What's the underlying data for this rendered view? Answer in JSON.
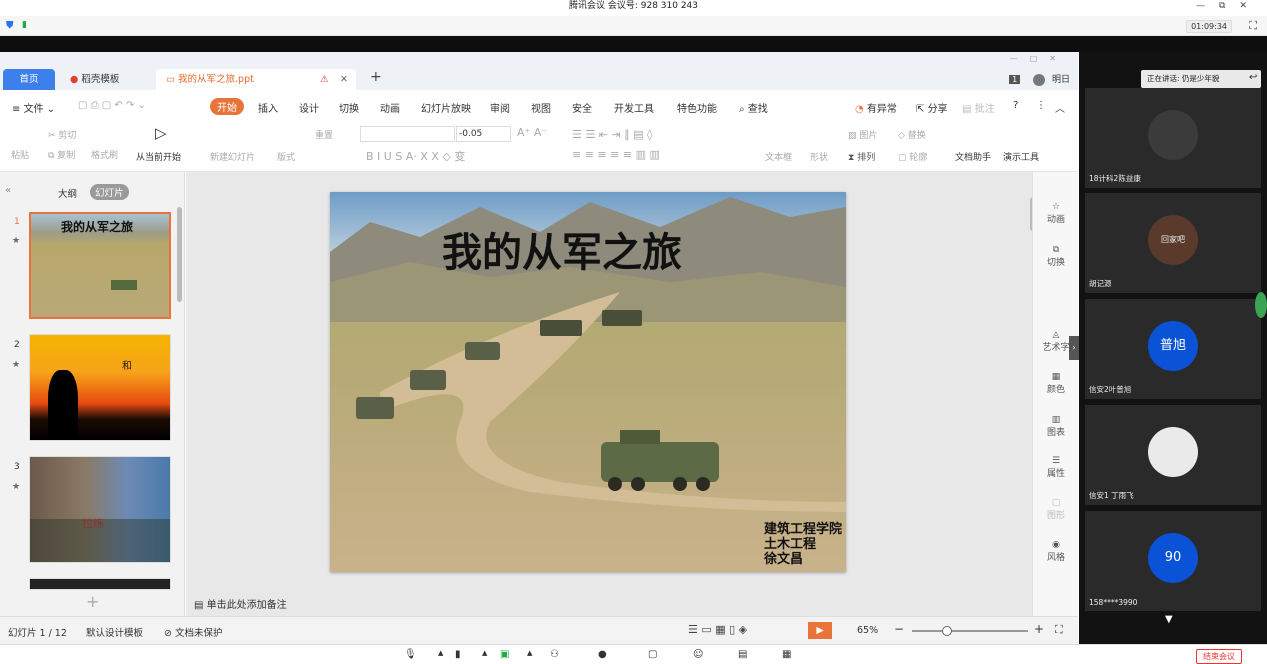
{
  "meeting": {
    "title": "腾讯会议 会议号: 928 310 243",
    "timer": "01:09:34",
    "end_label": "结束会议"
  },
  "wps": {
    "tabs": {
      "home": "首页",
      "template": "稻壳模板",
      "doc": "我的从军之旅.ppt"
    },
    "user": "明日",
    "menu": [
      "文件",
      "开始",
      "插入",
      "设计",
      "切换",
      "动画",
      "幻灯片放映",
      "审阅",
      "视图",
      "安全",
      "开发工具",
      "特色功能",
      "查找"
    ],
    "menu_right": [
      "有异常",
      "分享",
      "批注"
    ],
    "toolbar": {
      "paste": "粘贴",
      "cut": "剪切",
      "copy": "复制",
      "format_painter": "格式刷",
      "play_from_current": "从当前开始",
      "new_slide": "新建幻灯片",
      "layout": "版式",
      "reset": "重置",
      "font_size_delta": "-0.05",
      "textbox": "文本框",
      "shape": "形状",
      "picture": "图片",
      "arrange": "排列",
      "replace": "替换",
      "outline": "轮廓",
      "doc_assistant": "文档助手",
      "present_tools": "演示工具"
    },
    "pane_tabs": {
      "outline": "大纲",
      "slides": "幻灯片"
    },
    "slides": [
      {
        "num": "1",
        "title": "我的从军之旅"
      },
      {
        "num": "2",
        "text": "和"
      },
      {
        "num": "3",
        "text": "拉练"
      }
    ],
    "current_slide": {
      "title": "我的从军之旅",
      "credits": [
        "建筑工程学院",
        "土木工程",
        "徐文昌"
      ]
    },
    "notes_placeholder": "单击此处添加备注",
    "right_panel": [
      "动画",
      "切换",
      "艺术字",
      "颜色",
      "图表",
      "属性",
      "图形",
      "风格"
    ],
    "status": {
      "slide_counter": "幻灯片 1 / 12",
      "design": "默认设计模板",
      "protect": "文档未保护",
      "zoom": "65%"
    }
  },
  "video": {
    "speaking": "正在讲话: 仍是少年貌",
    "participants": [
      {
        "name": "18计科2陈益康",
        "avatar": ""
      },
      {
        "name": "胡记源",
        "avatar": "回家吧"
      },
      {
        "name": "信安2叶普旭",
        "avatar": "普旭"
      },
      {
        "name": "信安1 丁雨飞",
        "avatar": ""
      },
      {
        "name": "158****3990",
        "avatar": "90"
      }
    ]
  },
  "colors": {
    "accent": "#3d80ec",
    "wps_orange": "#e8743c",
    "meeting_blue": "#0a52d6"
  }
}
